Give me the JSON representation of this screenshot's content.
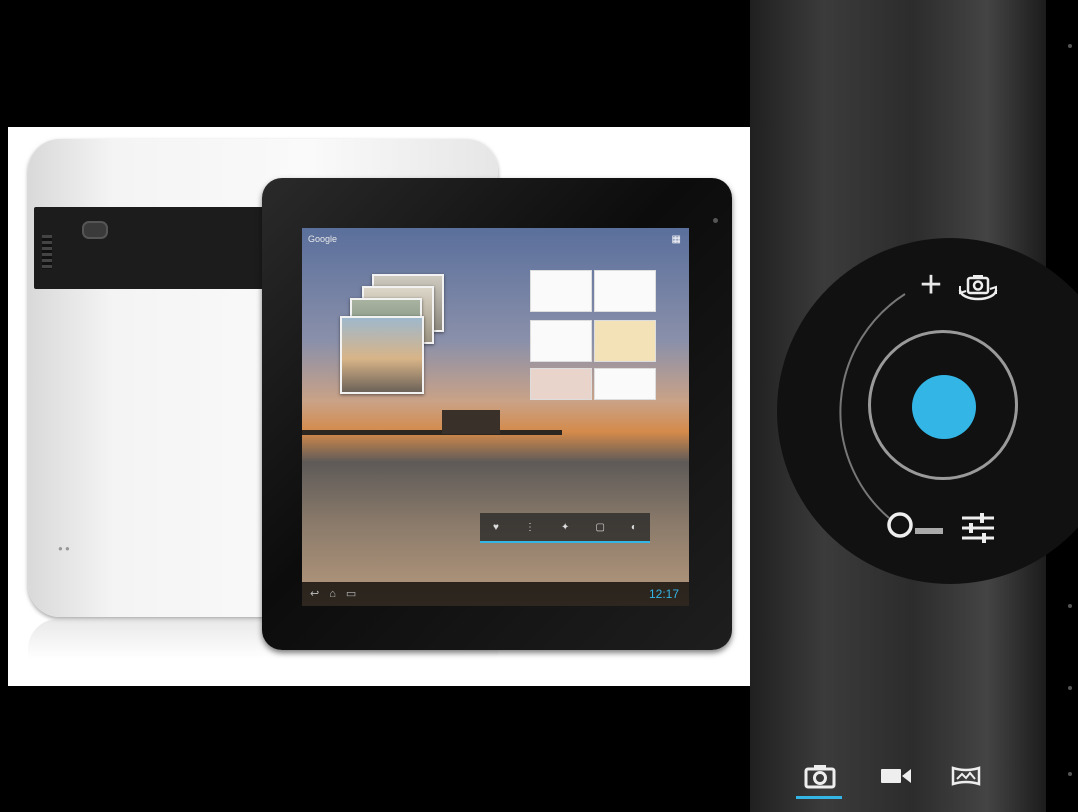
{
  "viewfinder": {
    "tablet_screen": {
      "top_left_text": "Google",
      "clock": "12:17"
    }
  },
  "controls": {
    "zoom_in_glyph": "+",
    "accent_color": "#33b5e5",
    "icons": {
      "zoom_in": "plus-icon",
      "switch_camera": "switch-camera-icon",
      "zoom_out": "zoom-out-slider-icon",
      "settings": "settings-sliders-icon",
      "shutter": "shutter-icon"
    }
  },
  "modes": {
    "selected": "photo",
    "icons": [
      "camera-icon",
      "video-camera-icon",
      "panorama-icon"
    ]
  }
}
